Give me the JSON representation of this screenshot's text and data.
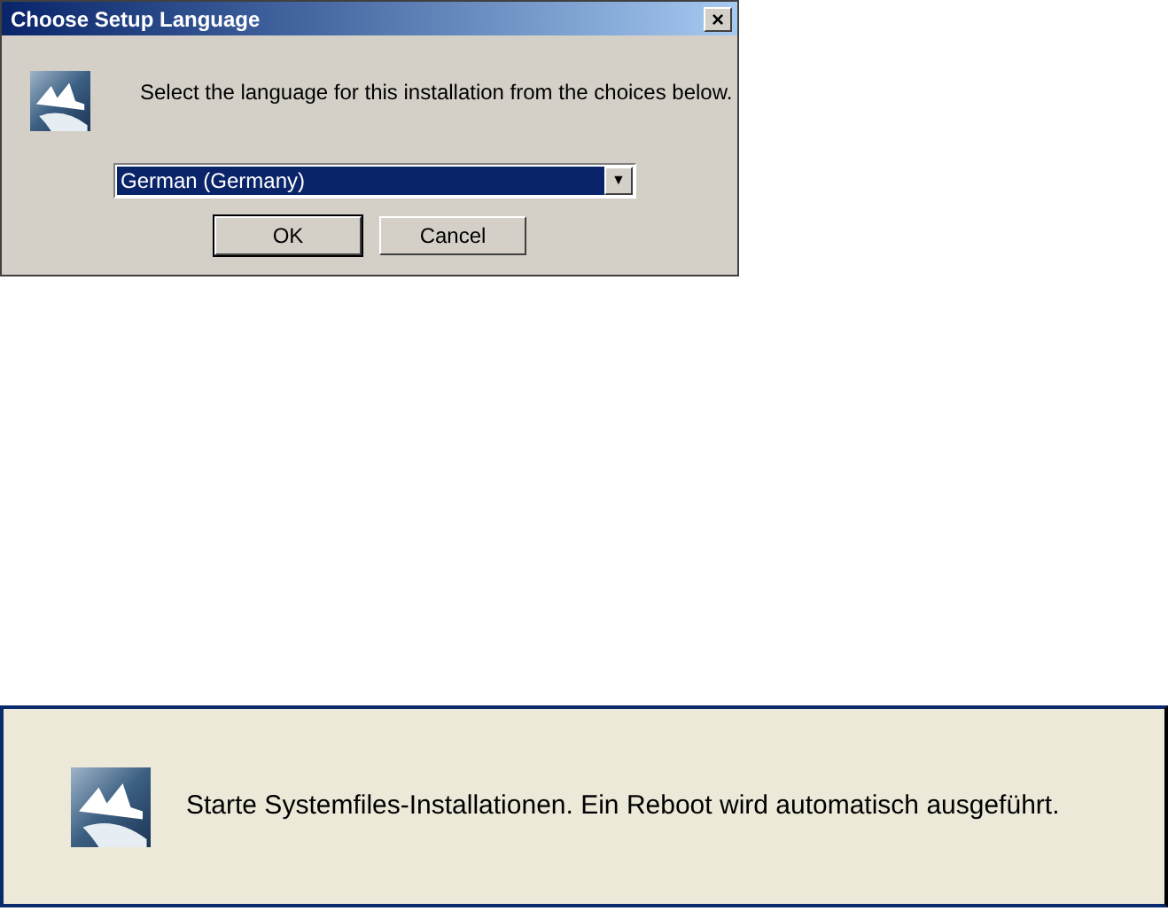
{
  "setup_dialog": {
    "title": "Choose Setup Language",
    "close_button": "×",
    "message": "Select the language for this installation from the choices below.",
    "language": {
      "value": "German (Germany)",
      "arrow": "▼"
    },
    "buttons": [
      "OK",
      "Cancel"
    ]
  },
  "progress_dialog": {
    "message": "Starte Systemfiles-Installationen. Ein Reboot wird automatisch ausgeführt."
  }
}
